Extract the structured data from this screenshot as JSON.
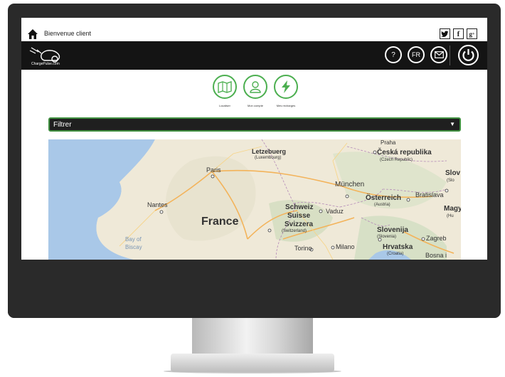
{
  "topbar": {
    "welcome": "Bienvenue client",
    "social": [
      "twitter-icon",
      "facebook-icon",
      "google-plus-icon"
    ]
  },
  "header": {
    "logo_text": "ChargePulse.com",
    "help_label": "?",
    "lang_label": "FR"
  },
  "nav": [
    {
      "label": "Localiser",
      "icon": "map-icon"
    },
    {
      "label": "Mon compte",
      "icon": "user-icon"
    },
    {
      "label": "Mes recharges",
      "icon": "lightning-icon"
    }
  ],
  "filter": {
    "label": "Filtrer"
  },
  "map": {
    "labels": [
      "Letzebuerg",
      "(Luxembourg)",
      "Praha",
      "Česká republika",
      "(Czech Republic)",
      "Slov",
      "(Slo",
      "Paris",
      "München",
      "Österreich",
      "(Austria)",
      "Bratislava",
      "Nantes",
      "Schweiz",
      "Suisse",
      "Svizzera",
      "(Switzerland)",
      "Vaduz",
      "Magy",
      "(Hu",
      "France",
      "Slovenija",
      "(Slovenia)",
      "Zagreb",
      "Bay of",
      "Biscay",
      "Torino",
      "Milano",
      "Hrvatska",
      "Bosna i",
      "(Croatia)"
    ]
  },
  "colors": {
    "accent": "#4caf50",
    "header_bg": "#141414"
  }
}
